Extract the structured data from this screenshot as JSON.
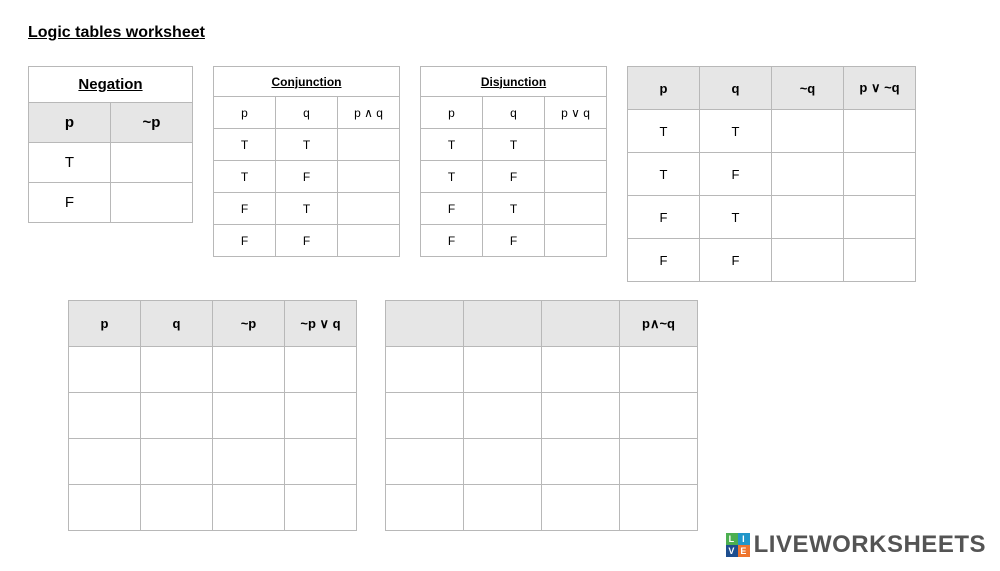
{
  "title": "Logic tables worksheet",
  "negation": {
    "title": "Negation",
    "headers": [
      "p",
      "~p"
    ],
    "rows": [
      [
        "T",
        ""
      ],
      [
        "F",
        ""
      ]
    ]
  },
  "conjunction": {
    "title": "Conjunction",
    "headers": [
      "p",
      "q",
      "p ∧ q"
    ],
    "rows": [
      [
        "T",
        "T",
        ""
      ],
      [
        "T",
        "F",
        ""
      ],
      [
        "F",
        "T",
        ""
      ],
      [
        "F",
        "F",
        ""
      ]
    ]
  },
  "disjunction": {
    "title": "Disjunction",
    "headers": [
      "p",
      "q",
      "p ∨ q"
    ],
    "rows": [
      [
        "T",
        "T",
        ""
      ],
      [
        "T",
        "F",
        ""
      ],
      [
        "F",
        "T",
        ""
      ],
      [
        "F",
        "F",
        ""
      ]
    ]
  },
  "expr1": {
    "headers": [
      "p",
      "q",
      "~q",
      "p ∨ ~q"
    ],
    "rows": [
      [
        "T",
        "T",
        "",
        ""
      ],
      [
        "T",
        "F",
        "",
        ""
      ],
      [
        "F",
        "T",
        "",
        ""
      ],
      [
        "F",
        "F",
        "",
        ""
      ]
    ]
  },
  "expr2": {
    "headers": [
      "p",
      "q",
      "~p",
      "~p ∨ q"
    ],
    "rows": [
      [
        "",
        "",
        "",
        ""
      ],
      [
        "",
        "",
        "",
        ""
      ],
      [
        "",
        "",
        "",
        ""
      ],
      [
        "",
        "",
        "",
        ""
      ]
    ]
  },
  "expr3": {
    "headers": [
      "",
      "",
      "",
      "p∧~q"
    ],
    "rows": [
      [
        "",
        "",
        "",
        ""
      ],
      [
        "",
        "",
        "",
        ""
      ],
      [
        "",
        "",
        "",
        ""
      ],
      [
        "",
        "",
        "",
        ""
      ]
    ]
  },
  "watermark": {
    "text": "LIVEWORKSHEETS",
    "badge": [
      "L",
      "I",
      "V",
      "E"
    ]
  }
}
